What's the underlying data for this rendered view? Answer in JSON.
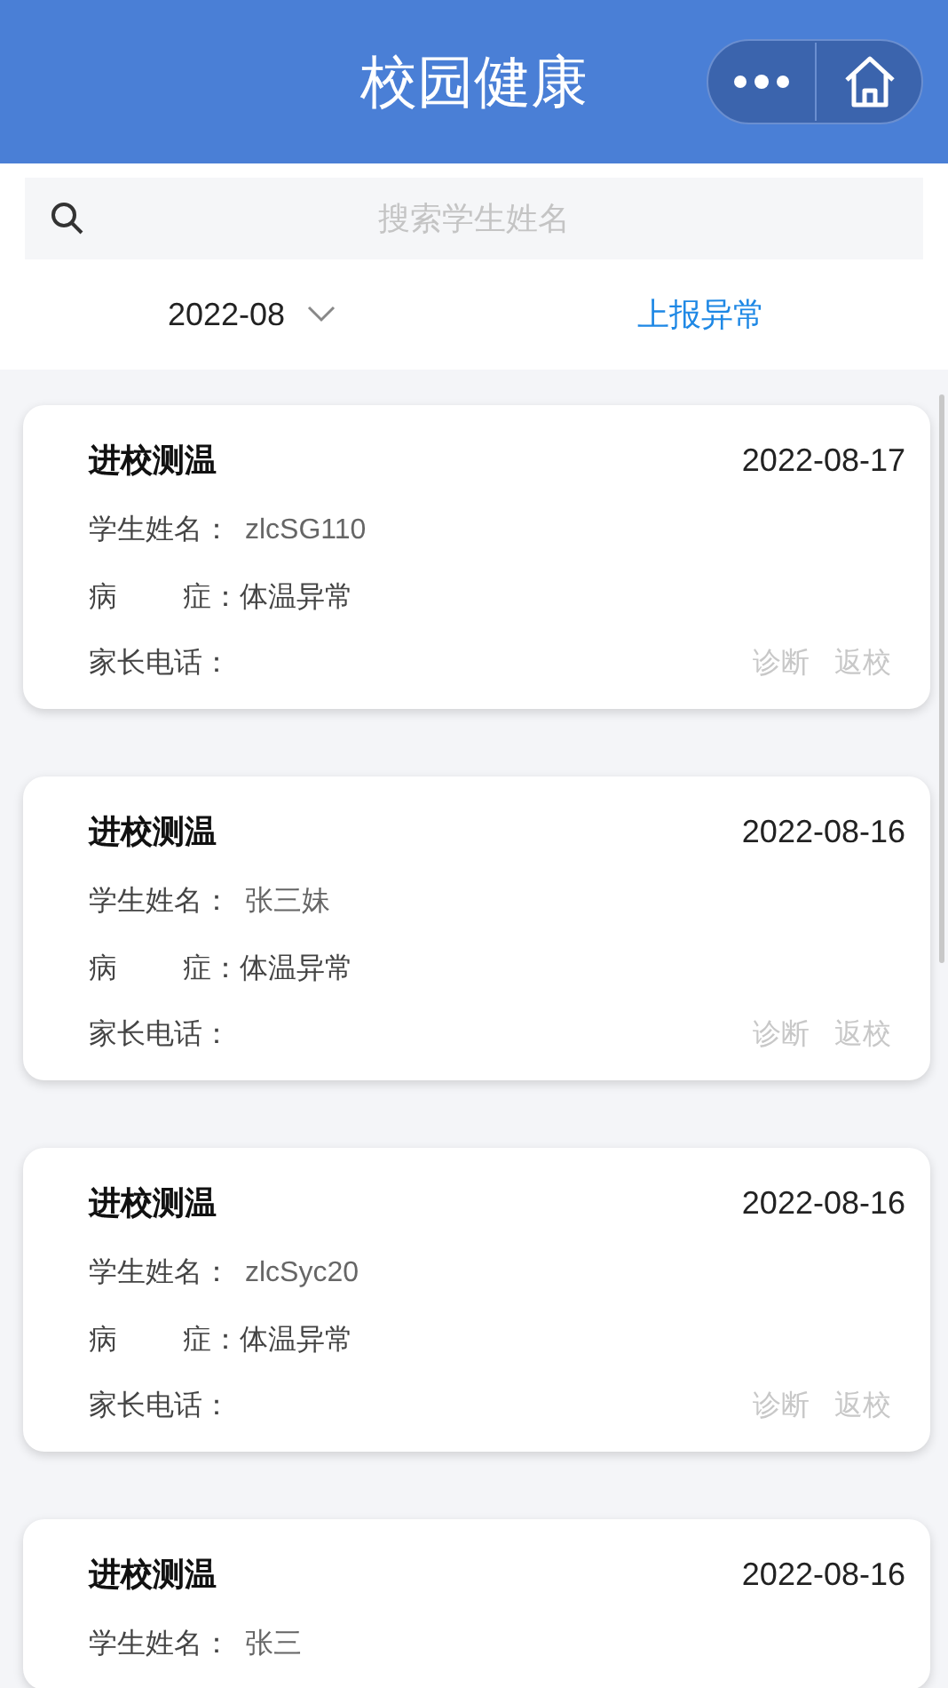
{
  "header": {
    "title": "校园健康"
  },
  "search": {
    "placeholder": "搜索学生姓名"
  },
  "filter": {
    "month": "2022-08",
    "report_link": "上报异常"
  },
  "records": [
    {
      "type": "进校测温",
      "date": "2022-08-17",
      "name_label": "学生姓名：",
      "name": "zlcSG110",
      "symptom_label": [
        "病",
        "症："
      ],
      "symptom": "体温异常",
      "phone_label": "家长电话：",
      "actions": [
        "诊断",
        "返校"
      ]
    },
    {
      "type": "进校测温",
      "date": "2022-08-16",
      "name_label": "学生姓名：",
      "name": "张三妹",
      "symptom_label": [
        "病",
        "症："
      ],
      "symptom": "体温异常",
      "phone_label": "家长电话：",
      "actions": [
        "诊断",
        "返校"
      ]
    },
    {
      "type": "进校测温",
      "date": "2022-08-16",
      "name_label": "学生姓名：",
      "name": "zlcSyc20",
      "symptom_label": [
        "病",
        "症："
      ],
      "symptom": "体温异常",
      "phone_label": "家长电话：",
      "actions": [
        "诊断",
        "返校"
      ]
    },
    {
      "type": "进校测温",
      "date": "2022-08-16",
      "name_label": "学生姓名：",
      "name": "张三"
    }
  ]
}
